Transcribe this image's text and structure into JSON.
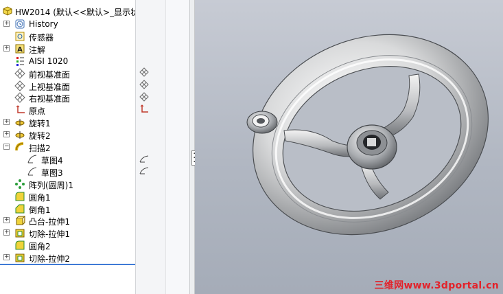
{
  "tree": {
    "root_label": "HW2014  (默认<<默认>_显示状",
    "items": [
      {
        "label": "History",
        "icon": "history-icon",
        "expandable": true
      },
      {
        "label": "传感器",
        "icon": "sensor-icon",
        "expandable": false
      },
      {
        "label": "注解",
        "icon": "annotation-icon",
        "expandable": true
      },
      {
        "label": "AISI 1020",
        "icon": "material-icon",
        "expandable": false
      },
      {
        "label": "前视基准面",
        "icon": "plane-icon",
        "expandable": false
      },
      {
        "label": "上视基准面",
        "icon": "plane-icon",
        "expandable": false
      },
      {
        "label": "右视基准面",
        "icon": "plane-icon",
        "expandable": false
      },
      {
        "label": "原点",
        "icon": "origin-icon",
        "expandable": false
      },
      {
        "label": "旋转1",
        "icon": "revolve-icon",
        "expandable": true
      },
      {
        "label": "旋转2",
        "icon": "revolve-icon",
        "expandable": true
      },
      {
        "label": "扫描2",
        "icon": "sweep-icon",
        "expandable": true,
        "expanded": true
      },
      {
        "label": "草图4",
        "icon": "sketch-icon",
        "expandable": false,
        "child": true
      },
      {
        "label": "草图3",
        "icon": "sketch-icon",
        "expandable": false,
        "child": true
      },
      {
        "label": "阵列(圆周)1",
        "icon": "pattern-icon",
        "expandable": false
      },
      {
        "label": "圆角1",
        "icon": "fillet-icon",
        "expandable": false
      },
      {
        "label": "倒角1",
        "icon": "chamfer-icon",
        "expandable": false
      },
      {
        "label": "凸台-拉伸1",
        "icon": "extrude-icon",
        "expandable": true
      },
      {
        "label": "切除-拉伸1",
        "icon": "cut-extrude-icon",
        "expandable": true
      },
      {
        "label": "圆角2",
        "icon": "fillet-icon",
        "expandable": false
      },
      {
        "label": "切除-拉伸2",
        "icon": "cut-extrude-icon",
        "expandable": true
      }
    ]
  },
  "viewport": {
    "model_name": "handwheel-model",
    "watermark": "三维网www.3dportal.cn"
  },
  "colors": {
    "accent": "#3f7ad6",
    "watermark": "#e3222a",
    "viewport_top": "#c7cbd4",
    "viewport_bottom": "#a5acb8"
  }
}
